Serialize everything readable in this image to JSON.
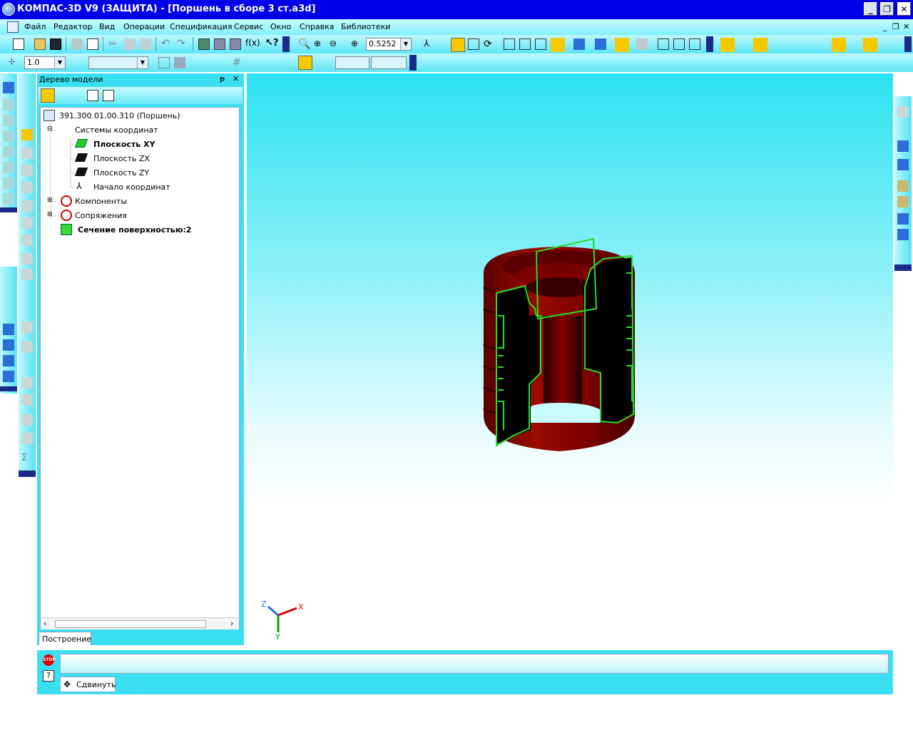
{
  "window": {
    "title": "КОМПАС-3D V9 (ЗАЩИТА) - [Поршень в сборе 3 ст.a3d]",
    "minimize": "_",
    "maximize": "❐",
    "close": "✕"
  },
  "menu": {
    "items": [
      "Файл",
      "Редактор",
      "Вид",
      "Операции",
      "Спецификация",
      "Сервис",
      "Окно",
      "Справка",
      "Библиотеки"
    ],
    "mdi_min": "_",
    "mdi_restore": "❐",
    "mdi_close": "✕"
  },
  "toolbar": {
    "zoom_value": "0.5252",
    "fx_label": "f(x)",
    "step_value": "1.0",
    "style_value": "",
    "coord_x": "",
    "coord_y": ""
  },
  "tree_panel": {
    "title": "Дерево модели",
    "pin": "ᵽ",
    "close": "✕",
    "tab_label": "Построение",
    "nodes": [
      {
        "label": "391.300.01.00.310 (Поршень)",
        "bold": false
      },
      {
        "label": "Системы координат",
        "bold": false
      },
      {
        "label": "Плоскость XY",
        "bold": true
      },
      {
        "label": "Плоскость ZX",
        "bold": false
      },
      {
        "label": "Плоскость ZY",
        "bold": false
      },
      {
        "label": "Начало координат",
        "bold": false
      },
      {
        "label": "Компоненты",
        "bold": false
      },
      {
        "label": "Сопряжения",
        "bold": false
      },
      {
        "label": "Сечение поверхностью:2",
        "bold": true
      }
    ],
    "expanders": [
      "⊟",
      "⊞",
      "⊞"
    ]
  },
  "axes": {
    "x": "X",
    "y": "Y",
    "z": "Z"
  },
  "status": {
    "stop_label": "STOP",
    "help_label": "?",
    "command_label": "Сдвинуть",
    "message": ""
  },
  "colors": {
    "title_bar": "#0000e8",
    "panel_cyan": "#3ae0f2",
    "part_red": "#8a0000",
    "section_outline": "#22e022",
    "highlight_yellow": "#f5c800"
  }
}
